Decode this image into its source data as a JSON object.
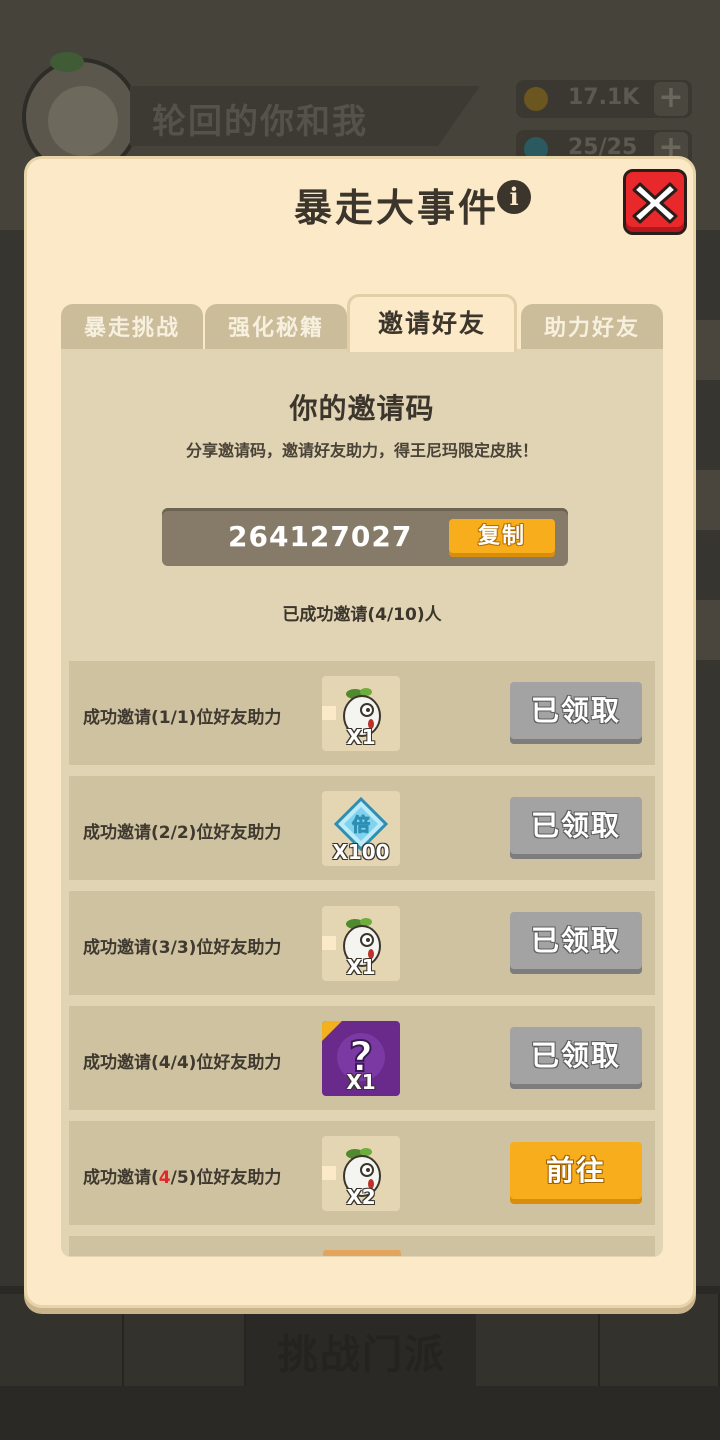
{
  "background": {
    "player_name": "轮回的你和我",
    "resources": [
      {
        "icon": "coin-icon",
        "value": "17.1K",
        "color": "#8a6a1e"
      },
      {
        "icon": "energy-icon",
        "value": "25/25",
        "color": "#2d6a73"
      }
    ],
    "bottom_label": "挑战门派"
  },
  "modal": {
    "title": "暴走大事件",
    "info_symbol": "i",
    "tabs": [
      {
        "label": "暴走挑战",
        "active": false
      },
      {
        "label": "强化秘籍",
        "active": false
      },
      {
        "label": "邀请好友",
        "active": true
      },
      {
        "label": "助力好友",
        "active": false
      }
    ],
    "invite": {
      "heading": "你的邀请码",
      "subtitle": "分享邀请码，邀请好友助力，得王尼玛限定皮肤！",
      "code": "264127027",
      "copy_label": "复制",
      "progress_text": "已成功邀请(4/10)人"
    },
    "rewards": [
      {
        "label_pre": "成功邀请(",
        "label_num": "1",
        "label_mid": "/1)位好友助力",
        "item": "radish-icon",
        "qty": "X1",
        "button": "已领取",
        "state": "claimed"
      },
      {
        "label_pre": "成功邀请(",
        "label_num": "2",
        "label_mid": "/2)位好友助力",
        "item": "diamond-bei-icon",
        "qty": "X100",
        "button": "已领取",
        "state": "claimed"
      },
      {
        "label_pre": "成功邀请(",
        "label_num": "3",
        "label_mid": "/3)位好友助力",
        "item": "radish-icon",
        "qty": "X1",
        "button": "已领取",
        "state": "claimed"
      },
      {
        "label_pre": "成功邀请(",
        "label_num": "4",
        "label_mid": "/4)位好友助力",
        "item": "mystery-box-icon",
        "qty": "X1",
        "button": "已领取",
        "state": "claimed"
      },
      {
        "label_pre": "成功邀请(",
        "label_num": "4",
        "label_mid": "/5)位好友助力",
        "item": "radish-icon",
        "qty": "X2",
        "button": "前往",
        "state": "go"
      }
    ]
  }
}
